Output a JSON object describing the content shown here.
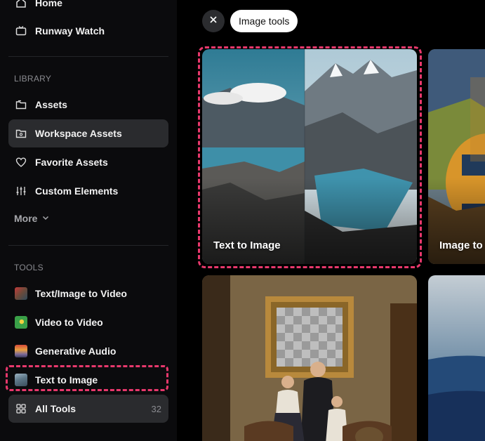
{
  "sidebar": {
    "home": "Home",
    "runway_watch": "Runway Watch",
    "library_label": "LIBRARY",
    "assets": "Assets",
    "workspace_assets": "Workspace Assets",
    "favorite_assets": "Favorite Assets",
    "custom_elements": "Custom Elements",
    "more": "More",
    "tools_label": "TOOLS",
    "text_image_to_video": "Text/Image to Video",
    "video_to_video": "Video to Video",
    "generative_audio": "Generative Audio",
    "text_to_image": "Text to Image",
    "all_tools": "All Tools",
    "all_tools_count": "32"
  },
  "filter": {
    "chip_label": "Image tools"
  },
  "cards": {
    "text_to_image": "Text to Image",
    "image_to": "Image to"
  },
  "colors": {
    "highlight": "#e8386c",
    "active_bg": "#2a2b2e"
  }
}
